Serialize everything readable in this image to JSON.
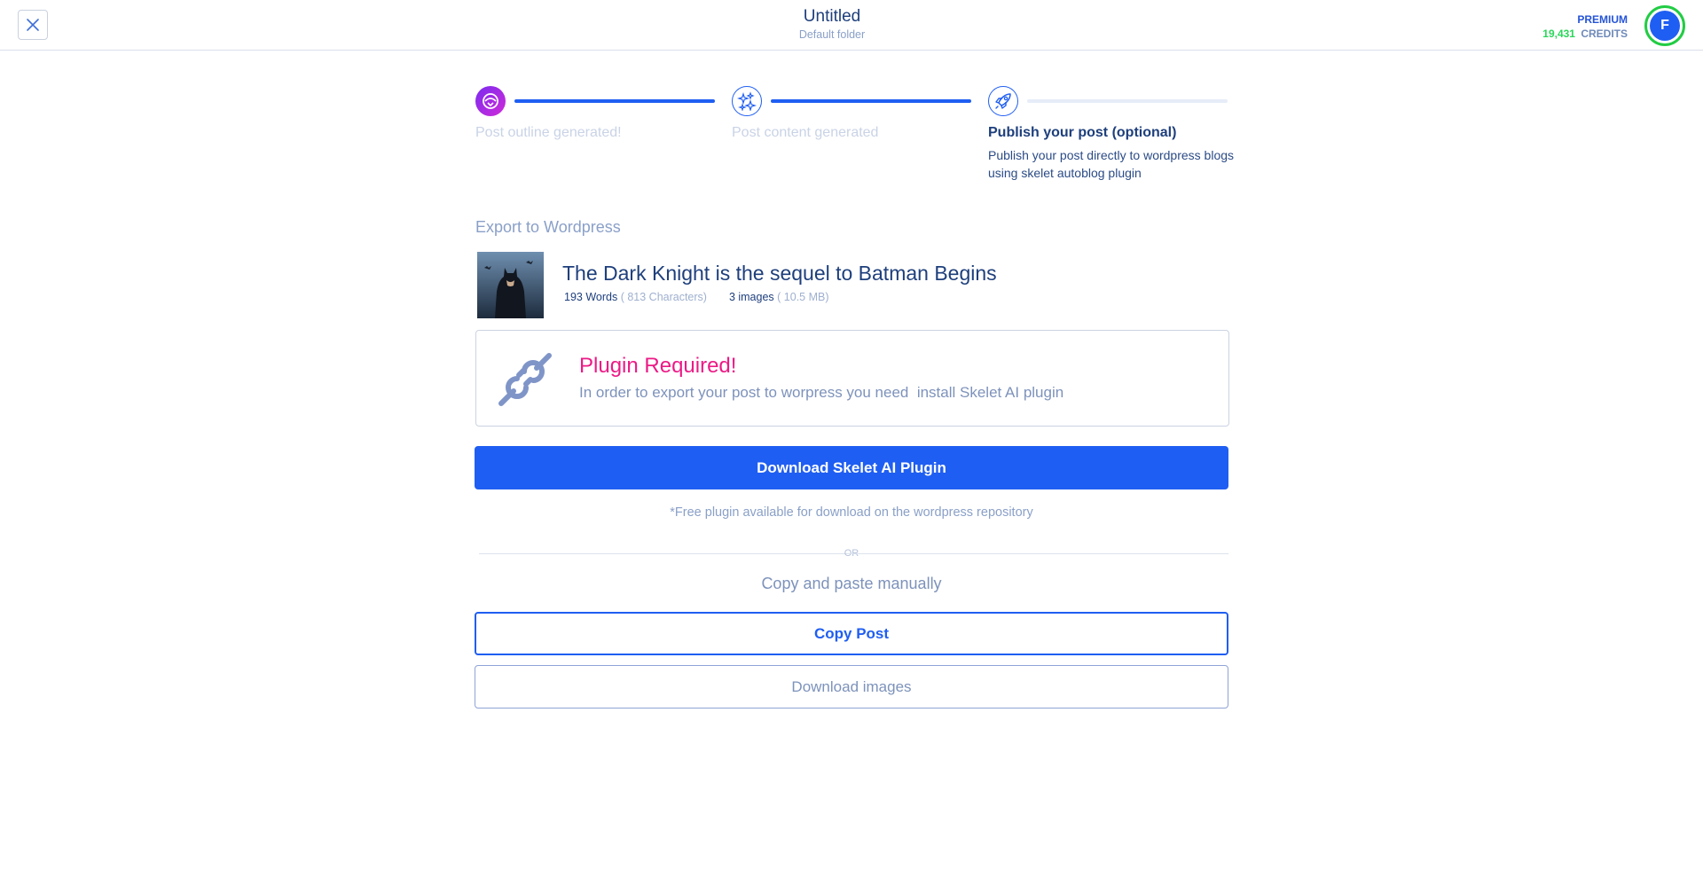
{
  "header": {
    "close_icon": "close-icon",
    "title": "Untitled",
    "folder": "Default folder",
    "plan_label": "PREMIUM",
    "credits_value": "19,431",
    "credits_label": "CREDITS",
    "avatar_initial": "F"
  },
  "stepper": {
    "steps": [
      {
        "title": "Post outline generated!",
        "icon": "outline-generated-icon",
        "state": "done"
      },
      {
        "title": "Post content generated",
        "icon": "sparkles-icon",
        "state": "done"
      },
      {
        "title": "Publish your post (optional)",
        "icon": "rocket-icon",
        "state": "active",
        "description": "Publish your post directly to wordpress blogs using skelet autoblog plugin"
      }
    ]
  },
  "export": {
    "section_label": "Export to Wordpress",
    "post_title": "The Dark Knight is the sequel to Batman Begins",
    "words": "193 Words",
    "characters": "( 813 Characters)",
    "images": "3 images",
    "images_size": "( 10.5 MB)"
  },
  "plugin": {
    "icon": "plug-icon",
    "title": "Plugin Required!",
    "text": "In order to export your post to worpress you need  install Skelet AI plugin"
  },
  "actions": {
    "download_plugin_label": "Download Skelet AI Plugin",
    "free_note": "*Free plugin available for download on the wordpress repository",
    "or_label": "OR",
    "manual_label": "Copy and paste manually",
    "copy_post_label": "Copy Post",
    "download_images_label": "Download images"
  },
  "colors": {
    "primary": "#1f5ef2",
    "accent_pink": "#ec1a86",
    "credits_green": "#2bd65a",
    "muted_text": "#8aa0c8",
    "dark_text": "#1e3f7c"
  }
}
